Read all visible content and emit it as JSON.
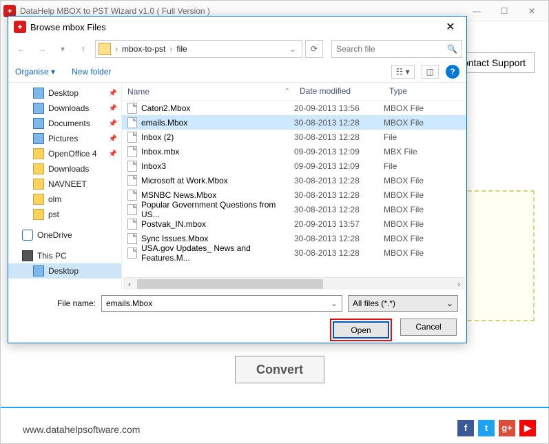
{
  "app": {
    "title": "DataHelp MBOX to PST Wizard v1.0 ( Full Version )",
    "contact_support": "ontact Support",
    "convert": "Convert",
    "footer_url": "www.datahelpsoftware.com"
  },
  "dialog": {
    "title": "Browse mbox Files",
    "breadcrumb": {
      "seg1": "mbox-to-pst",
      "seg2": "file"
    },
    "search_placeholder": "Search file",
    "organise": "Organise",
    "new_folder": "New folder",
    "headers": {
      "name": "Name",
      "date": "Date modified",
      "type": "Type"
    },
    "tree": [
      {
        "label": "Desktop",
        "icon": "blue",
        "pin": true,
        "depth": 1
      },
      {
        "label": "Downloads",
        "icon": "blue",
        "pin": true,
        "depth": 1
      },
      {
        "label": "Documents",
        "icon": "blue",
        "pin": true,
        "depth": 1
      },
      {
        "label": "Pictures",
        "icon": "blue",
        "pin": true,
        "depth": 1
      },
      {
        "label": "OpenOffice 4",
        "icon": "folder",
        "pin": true,
        "depth": 1
      },
      {
        "label": "Downloads",
        "icon": "folder",
        "pin": false,
        "depth": 1
      },
      {
        "label": "NAVNEET",
        "icon": "folder",
        "pin": false,
        "depth": 1
      },
      {
        "label": "olm",
        "icon": "folder",
        "pin": false,
        "depth": 1
      },
      {
        "label": "pst",
        "icon": "folder",
        "pin": false,
        "depth": 1
      },
      {
        "label": "",
        "icon": "",
        "pin": false,
        "depth": 0,
        "spacer": true
      },
      {
        "label": "OneDrive",
        "icon": "cloud",
        "pin": false,
        "depth": 0
      },
      {
        "label": "",
        "icon": "",
        "pin": false,
        "depth": 0,
        "spacer": true
      },
      {
        "label": "This PC",
        "icon": "monitor",
        "pin": false,
        "depth": 0
      },
      {
        "label": "Desktop",
        "icon": "blue",
        "pin": false,
        "depth": 1,
        "selected": true
      }
    ],
    "files": [
      {
        "name": "Caton2.Mbox",
        "date": "20-09-2013 13:56",
        "type": "MBOX File"
      },
      {
        "name": "emails.Mbox",
        "date": "30-08-2013 12:28",
        "type": "MBOX File",
        "selected": true
      },
      {
        "name": "Inbox (2)",
        "date": "30-08-2013 12:28",
        "type": "File"
      },
      {
        "name": "Inbox.mbx",
        "date": "09-09-2013 12:09",
        "type": "MBX File"
      },
      {
        "name": "Inbox3",
        "date": "09-09-2013 12:09",
        "type": "File"
      },
      {
        "name": "Microsoft at Work.Mbox",
        "date": "30-08-2013 12:28",
        "type": "MBOX File"
      },
      {
        "name": "MSNBC News.Mbox",
        "date": "30-08-2013 12:28",
        "type": "MBOX File"
      },
      {
        "name": "Popular Government Questions from US...",
        "date": "30-08-2013 12:28",
        "type": "MBOX File"
      },
      {
        "name": "Postvak_IN.mbox",
        "date": "20-09-2013 13:57",
        "type": "MBOX File"
      },
      {
        "name": "Sync Issues.Mbox",
        "date": "30-08-2013 12:28",
        "type": "MBOX File"
      },
      {
        "name": "USA.gov Updates_ News and Features.M...",
        "date": "30-08-2013 12:28",
        "type": "MBOX File"
      }
    ],
    "filename_label": "File name:",
    "filename_value": "emails.Mbox",
    "filter": "All files (*.*)",
    "open": "Open",
    "cancel": "Cancel"
  }
}
